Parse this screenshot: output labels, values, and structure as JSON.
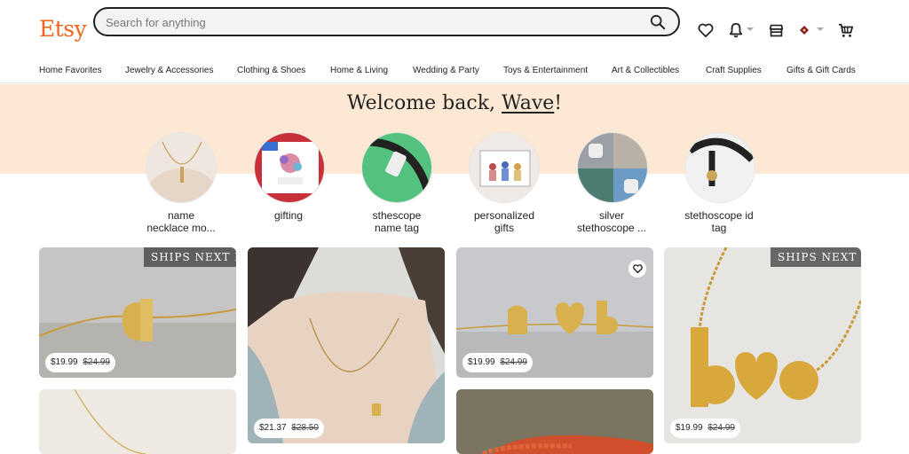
{
  "header": {
    "logo": "Etsy",
    "search_placeholder": "Search for anything",
    "icons": [
      "search-icon",
      "heart-icon",
      "bell-icon",
      "shop-icon",
      "avatar-icon",
      "cart-icon"
    ]
  },
  "nav": {
    "items": [
      "Home Favorites",
      "Jewelry & Accessories",
      "Clothing & Shoes",
      "Home & Living",
      "Wedding & Party",
      "Toys & Entertainment",
      "Art & Collectibles",
      "Craft Supplies",
      "Gifts & Gift Cards"
    ]
  },
  "hero": {
    "welcome_prefix": "Welcome back, ",
    "user_name": "Wave",
    "welcome_suffix": "!"
  },
  "categories": [
    {
      "line1": "name",
      "line2": "necklace mo..."
    },
    {
      "line1": "gifting",
      "line2": ""
    },
    {
      "line1": "sthescope",
      "line2": "name tag"
    },
    {
      "line1": "personalized",
      "line2": "gifts"
    },
    {
      "line1": "silver",
      "line2": "stethoscope ..."
    },
    {
      "line1": "stethoscope id",
      "line2": "tag"
    }
  ],
  "listings": [
    {
      "price": "$19.99",
      "original": "$24.99",
      "badge": "SHIPS NEXT DAY"
    },
    {
      "price": "$21.37",
      "original": "$28.50",
      "badge": ""
    },
    {
      "price": "$19.99",
      "original": "$24.99",
      "badge": ""
    },
    {
      "price": "$19.99",
      "original": "$24.99",
      "badge": "SHIPS NEXT D"
    }
  ],
  "colors": {
    "brand": "#f1641e",
    "hero_bg": "#fde9d3"
  }
}
